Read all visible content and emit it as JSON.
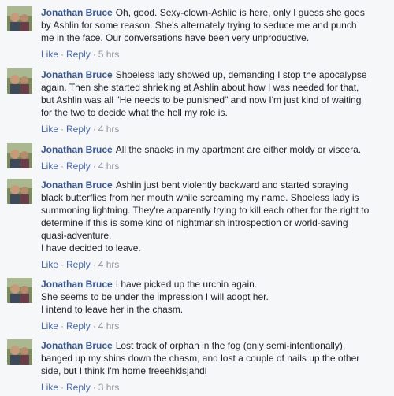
{
  "actions": {
    "like": "Like",
    "reply": "Reply",
    "separator": "·"
  },
  "comments": [
    {
      "author": "Jonathan Bruce",
      "lines": [
        "Oh, good. Sexy-clown-Ashlie is here, only I guess she goes",
        "by Ashlin for some reason. She's alternately trying to seduce me and punch",
        "me in the face. Our conversations have been very unproductive."
      ],
      "time": "5 hrs"
    },
    {
      "author": "Jonathan Bruce",
      "lines": [
        "Shoeless lady showed up, demanding I stop the apocalypse",
        "again. Then she started shrieking at Ashlin about how I was needed for that,",
        "but Ashlin was all \"He needs to be punished\" and now I'm just kind of waiting",
        "for the two to decide what the hell my role is."
      ],
      "time": "4 hrs"
    },
    {
      "author": "Jonathan Bruce",
      "lines": [
        "All the snacks in my apartment are either moldy or viscera."
      ],
      "time": "4 hrs"
    },
    {
      "author": "Jonathan Bruce",
      "lines": [
        "Ashlin just bent violently backward and started spraying",
        "black butterflies from her mouth while screaming my name. Shoeless lady is",
        "summoning lightning. They're apparently trying to kill each other for the right to",
        "determine if this is some kind of nightmarish introspection or world-saving",
        "quasi-adventure.",
        "I have decided to leave."
      ],
      "time": "4 hrs"
    },
    {
      "author": "Jonathan Bruce",
      "lines": [
        "I have picked up the urchin again.",
        "She seems to be under the impression I will adopt her.",
        "I intend to leave her in the chasm."
      ],
      "time": "4 hrs"
    },
    {
      "author": "Jonathan Bruce",
      "lines": [
        "Lost track of orphan in the fog (only semi-intentionally),",
        "banged up my shins down the chasm, and lost a couple of nails up the other",
        "side, but I think I'm home freeehklsjahdl"
      ],
      "time": "3 hrs"
    }
  ]
}
